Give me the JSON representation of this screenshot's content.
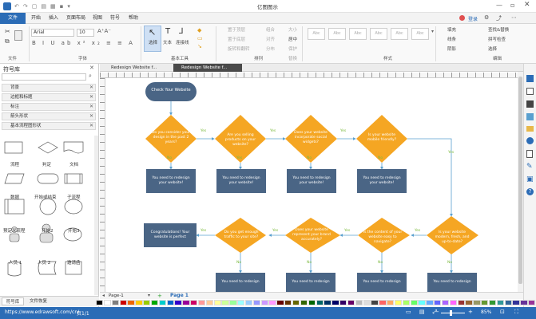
{
  "app": {
    "title": "亿图图示",
    "login_label": "登录"
  },
  "menus": [
    "文件",
    "开始",
    "插入",
    "页面布局",
    "视图",
    "符号",
    "帮助"
  ],
  "ribbon": {
    "font_name": "Arial",
    "font_size": "10",
    "groups": [
      "文件",
      "字体",
      "基本工具",
      "排列",
      "样式",
      "编辑"
    ],
    "tools": [
      "选择",
      "文本",
      "连接线"
    ],
    "arrange_buttons": [
      "置于顶层",
      "置于底层",
      "旋转和翻转",
      "组合",
      "对齐",
      "分布",
      "居中",
      "保护",
      "大小",
      "替换"
    ],
    "style_label": "Abc",
    "edit_buttons": [
      "填充",
      "线条",
      "阴影",
      "查找&替换",
      "拼写检查",
      "选择"
    ]
  },
  "library": {
    "title": "符号库",
    "categories": [
      "背景",
      "边框和标题",
      "标注",
      "箭头形状",
      "基本流程图形状"
    ],
    "shapes": [
      "流程",
      "判定",
      "文档",
      "数据",
      "开始或结束",
      "子流程",
      "预定义流程",
      "开始2",
      "开始3",
      "人员 1",
      "人员 2",
      "邀请函",
      "",
      "",
      ""
    ],
    "bottom_tabs": [
      "符号库",
      "文件恢复"
    ]
  },
  "tabs": [
    "Redesign Website f...",
    "Redesign Website f..."
  ],
  "pages": {
    "current": "Page-1",
    "tab": "Page 1"
  },
  "diagram": {
    "start": "Check Your Website",
    "decisions_row1": [
      "Do you consider your design in the past 2 years?",
      "Are you selling products on your website?",
      "Does your website incorporate social widgets?",
      "Is your website mobile friendly?"
    ],
    "actions_row1": [
      "You need to redesign your website!",
      "You need to redesign your website!",
      "You need to redesign your website!",
      "You need to redesign your website!"
    ],
    "decisions_row2": [
      "Do you get enough traffic to your site?",
      "Does your website represent your brand accurately?",
      "Is the content of your website easy to navigate?",
      "Is your website modern, fresh, and up-to-date?"
    ],
    "congrats": "Congratulations! Your website is perfect",
    "actions_row2": [
      "You need to redesign",
      "You need to redesign",
      "You need to redesign",
      "You need to redesign"
    ],
    "yes": "Yes",
    "no": "No"
  },
  "status": {
    "url": "https://www.edrawsoft.com/cn/",
    "page_info": "页1/1",
    "zoom": "85%"
  },
  "colors": {
    "accent": "#2b6cb6",
    "process": "#4a6585",
    "decision": "#f5a623",
    "connector": "#5aa0cf",
    "label": "#7cba3e"
  }
}
